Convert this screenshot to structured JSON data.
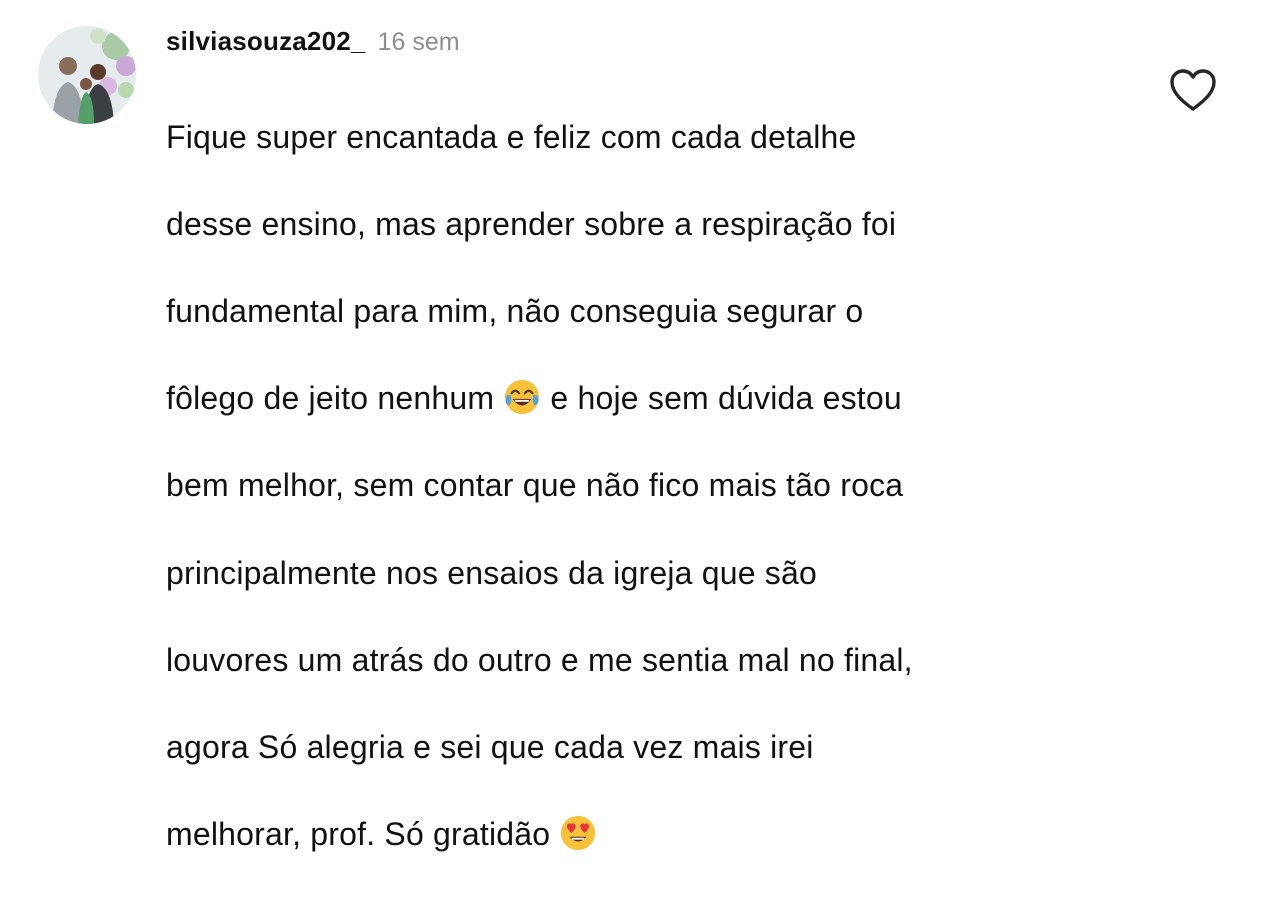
{
  "comment": {
    "username": "silviasouza202_",
    "time_ago": "16 sem",
    "lines": [
      {
        "text": "Fique super encantada e feliz com cada detalhe"
      },
      {
        "text": "desse ensino,  mas aprender sobre a respiração foi"
      },
      {
        "text": "fundamental para mim, não conseguia segurar o"
      },
      {
        "before": "fôlego de jeito nenhum ",
        "emoji": "tears-of-joy-emoji",
        "after": " e hoje sem dúvida estou"
      },
      {
        "text": "bem melhor,  sem contar que não fico mais tão roca"
      },
      {
        "text": "principalmente nos ensaios da igreja que são"
      },
      {
        "text": "louvores um atrás do outro e me sentia mal no final,"
      },
      {
        "text": "agora Só alegria e sei que cada vez mais irei"
      },
      {
        "before": "melhorar,  prof. Só gratidão ",
        "emoji": "heart-eyes-emoji",
        "after": ""
      }
    ],
    "like_icon": "heart-outline-icon",
    "colors": {
      "text": "#111111",
      "time": "#8e8e8e",
      "icon": "#262626",
      "emoji_yellow": "#f7c23a",
      "emoji_heart": "#e8333b",
      "emoji_tear": "#4fa3e0"
    }
  }
}
